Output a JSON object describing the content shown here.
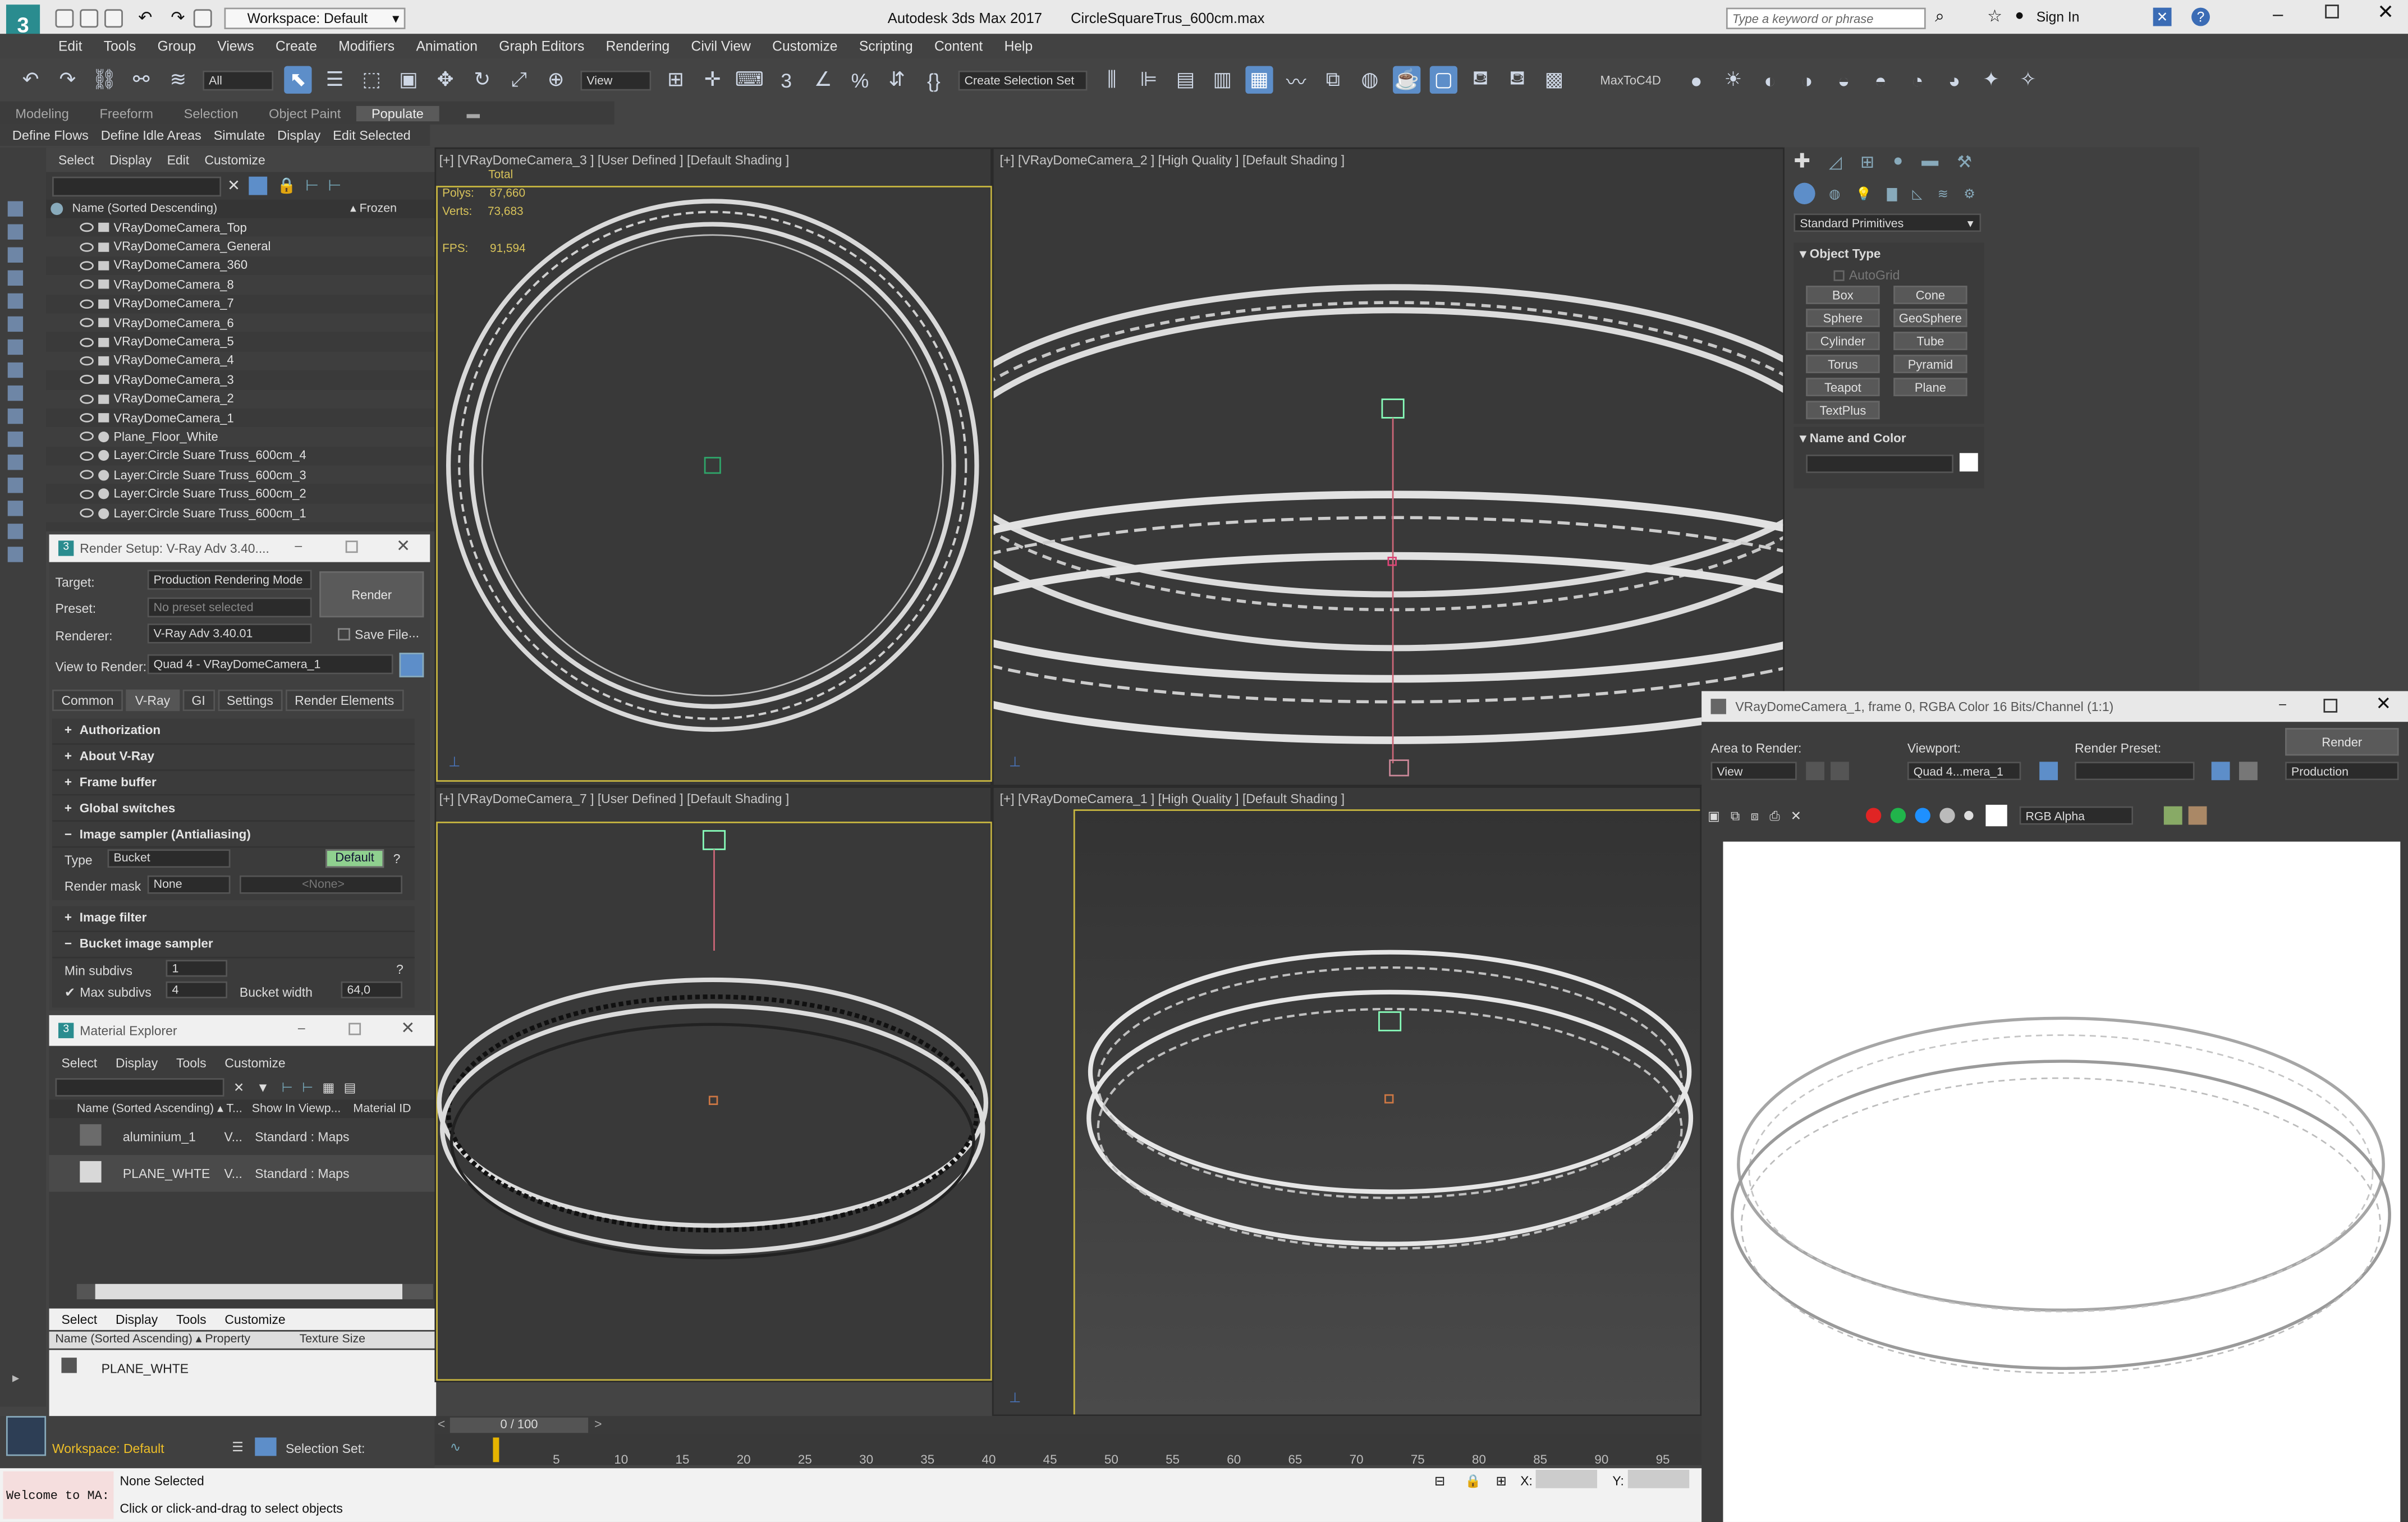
{
  "app": {
    "title": "Autodesk 3ds Max 2017",
    "file": "CircleSquareTrus_600cm.max",
    "workspace": "Workspace: Default",
    "search_placeholder": "Type a keyword or phrase",
    "sign_in": "Sign In"
  },
  "menu": [
    "Edit",
    "Tools",
    "Group",
    "Views",
    "Create",
    "Modifiers",
    "Animation",
    "Graph Editors",
    "Rendering",
    "Civil View",
    "Customize",
    "Scripting",
    "Content",
    "Help"
  ],
  "toolbar": {
    "filter": "All",
    "ref_coord": "View",
    "selection_set": "Create Selection Set",
    "plugin": "MaxToC4D"
  },
  "ribbon_tabs": [
    {
      "label": "Modeling"
    },
    {
      "label": "Freeform"
    },
    {
      "label": "Selection"
    },
    {
      "label": "Object Paint"
    },
    {
      "label": "Populate",
      "selected": true
    }
  ],
  "flow_tools": [
    "Define Flows",
    "Define Idle Areas",
    "Simulate",
    "Display",
    "Edit Selected"
  ],
  "scene_explorer": {
    "menu": [
      "Select",
      "Display",
      "Edit",
      "Customize"
    ],
    "col_name": "Name (Sorted Descending)",
    "col_frozen": "▴ Frozen",
    "rows": [
      {
        "label": "VRayDomeCamera_Top",
        "kind": "cam"
      },
      {
        "label": "VRayDomeCamera_General",
        "kind": "cam"
      },
      {
        "label": "VRayDomeCamera_360",
        "kind": "cam"
      },
      {
        "label": "VRayDomeCamera_8",
        "kind": "cam"
      },
      {
        "label": "VRayDomeCamera_7",
        "kind": "cam"
      },
      {
        "label": "VRayDomeCamera_6",
        "kind": "cam"
      },
      {
        "label": "VRayDomeCamera_5",
        "kind": "cam"
      },
      {
        "label": "VRayDomeCamera_4",
        "kind": "cam"
      },
      {
        "label": "VRayDomeCamera_3",
        "kind": "cam"
      },
      {
        "label": "VRayDomeCamera_2",
        "kind": "cam"
      },
      {
        "label": "VRayDomeCamera_1",
        "kind": "cam"
      },
      {
        "label": "Plane_Floor_White",
        "kind": "obj"
      },
      {
        "label": "Layer:Circle Suare Truss_600cm_4",
        "kind": "obj"
      },
      {
        "label": "Layer:Circle Suare Truss_600cm_3",
        "kind": "obj"
      },
      {
        "label": "Layer:Circle Suare Truss_600cm_2",
        "kind": "obj"
      },
      {
        "label": "Layer:Circle Suare Truss_600cm_1",
        "kind": "obj"
      }
    ]
  },
  "render_setup": {
    "title": "Render Setup: V-Ray Adv 3.40....",
    "target_label": "Target:",
    "target": "Production Rendering Mode",
    "preset_label": "Preset:",
    "preset": "No preset selected",
    "renderer_label": "Renderer:",
    "renderer": "V-Ray Adv 3.40.01",
    "save_file": "Save File",
    "ellipsis": "...",
    "view_label": "View to Render:",
    "view": "Quad 4 - VRayDomeCamera_1",
    "render_btn": "Render",
    "tabs": [
      {
        "label": "Common"
      },
      {
        "label": "V-Ray",
        "selected": true
      },
      {
        "label": "GI"
      },
      {
        "label": "Settings"
      },
      {
        "label": "Render Elements"
      }
    ],
    "rollouts_top": [
      {
        "label": "Authorization",
        "sign": "+"
      },
      {
        "label": "About V-Ray",
        "sign": "+"
      },
      {
        "label": "Frame buffer",
        "sign": "+"
      },
      {
        "label": "Global switches",
        "sign": "+"
      }
    ],
    "image_sampler": {
      "title": "Image sampler (Antialiasing)",
      "type_label": "Type",
      "type": "Bucket",
      "default_btn": "Default",
      "q": "?",
      "mask_label": "Render mask",
      "mask": "None",
      "mask_field": "<None>"
    },
    "image_filter": "Image filter",
    "bucket": {
      "title": "Bucket image sampler",
      "min_label": "Min subdivs",
      "min": "1",
      "max_label": "Max subdivs",
      "max": "4",
      "width_label": "Bucket width",
      "width": "64,0"
    }
  },
  "material_explorer": {
    "title": "Material Explorer",
    "menu": [
      "Select",
      "Display",
      "Tools",
      "Customize"
    ],
    "col_name": "Name (Sorted Ascending) ▴ T...",
    "col_show": "Show In Viewp...",
    "col_id": "Material ID",
    "rows": [
      {
        "name": "aluminium_1",
        "type": "V...",
        "show": "Standard : Maps"
      },
      {
        "name": "PLANE_WHTE",
        "type": "V...",
        "show": "Standard : Maps"
      }
    ],
    "lower_menu": [
      "Select",
      "Display",
      "Tools",
      "Customize"
    ],
    "lower_col_name": "Name (Sorted Ascending) ▴ Property",
    "lower_col_tex": "Texture Size",
    "lower_row": "PLANE_WHTE"
  },
  "viewports": [
    {
      "label": "[+] [VRayDomeCamera_3 ] [User Defined ] [Default Shading ]"
    },
    {
      "label": "[+] [VRayDomeCamera_2 ] [High Quality ] [Default Shading ]"
    },
    {
      "label": "[+] [VRayDomeCamera_7 ] [User Defined ] [Default Shading ]"
    },
    {
      "label": "[+] [VRayDomeCamera_1 ] [High Quality ] [Default Shading ]"
    }
  ],
  "stats": {
    "total": "Total",
    "polys_label": "Polys:",
    "polys": "87,660",
    "verts_label": "Verts:",
    "verts": "73,683",
    "fps_label": "FPS:",
    "fps": "91,594"
  },
  "command_panel": {
    "category": "Standard Primitives",
    "object_type": "Object Type",
    "autogrid": "AutoGrid",
    "buttons": [
      "Box",
      "Cone",
      "Sphere",
      "GeoSphere",
      "Cylinder",
      "Tube",
      "Torus",
      "Pyramid",
      "Teapot",
      "Plane",
      "TextPlus"
    ],
    "name_color": "Name and Color"
  },
  "frame_buffer": {
    "title": "VRayDomeCamera_1, frame 0, RGBA Color 16 Bits/Channel (1:1)",
    "area_label": "Area to Render:",
    "area": "View",
    "viewport_label": "Viewport:",
    "viewport": "Quad 4...mera_1",
    "preset_label": "Render Preset:",
    "render_btn": "Render",
    "mode": "Production",
    "channel": "RGB Alpha"
  },
  "timeline": {
    "frame": "0 / 100",
    "ticks": [
      "5",
      "10",
      "15",
      "20",
      "25",
      "30",
      "35",
      "40",
      "45",
      "50",
      "55",
      "60",
      "65",
      "70",
      "75",
      "80",
      "85",
      "90",
      "95"
    ]
  },
  "status": {
    "workspace": "Workspace: Default",
    "selection_set": "Selection Set:",
    "none_selected": "None Selected",
    "prompt": "Click or click-and-drag to select objects",
    "maxscript": "Welcome to MA:",
    "x_label": "X:",
    "y_label": "Y:"
  },
  "colors": {
    "bg": "#444444",
    "viewport": "#393939",
    "accent": "#5d8ec9",
    "stats_text": "#d8c35a"
  }
}
